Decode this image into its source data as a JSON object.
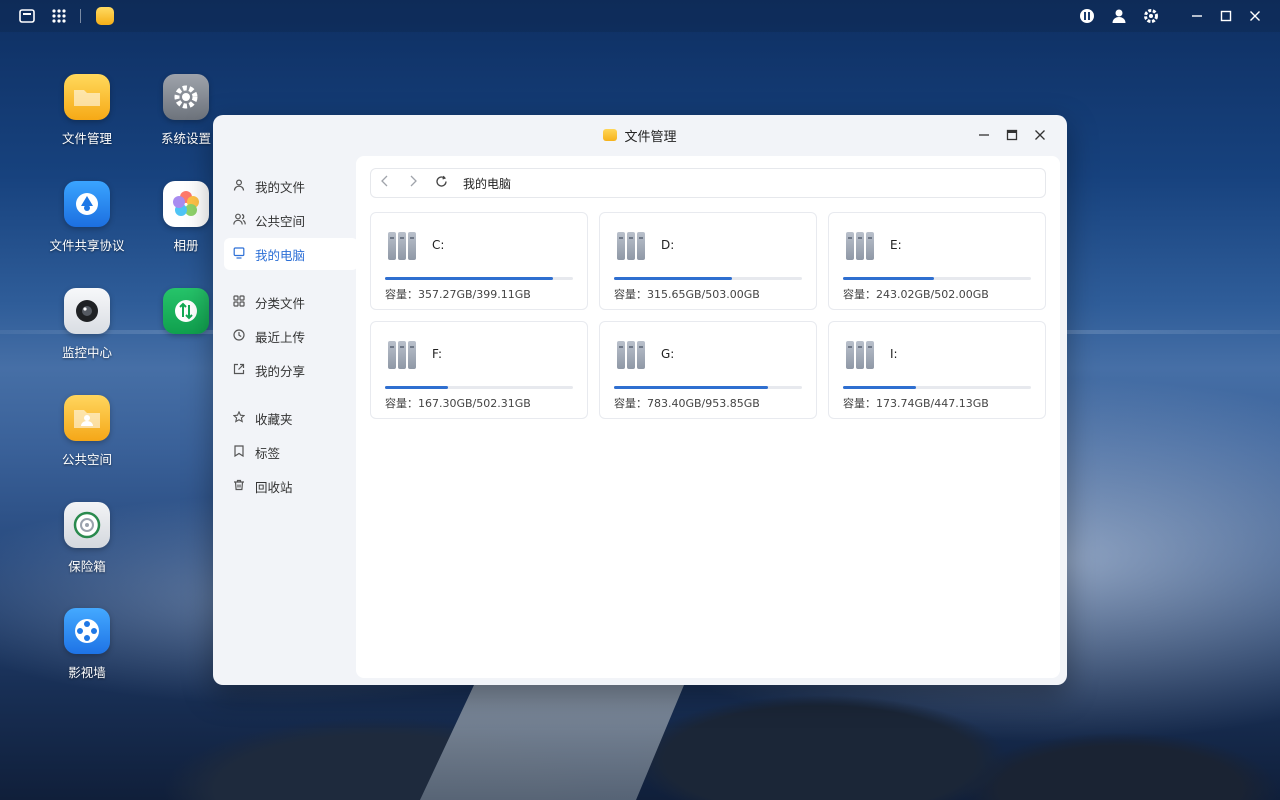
{
  "desktop": {
    "icons": [
      {
        "label": "文件管理",
        "icon": "folder-icon"
      },
      {
        "label": "系统设置",
        "icon": "gear-icon"
      },
      {
        "label": "文件共享协议",
        "icon": "share-protocol-icon"
      },
      {
        "label": "相册",
        "icon": "photos-icon"
      },
      {
        "label": "监控中心",
        "icon": "camera-icon"
      },
      {
        "label": "公共空间",
        "icon": "shared-folder-icon"
      },
      {
        "label": "保险箱",
        "icon": "safe-icon"
      },
      {
        "label": "影视墙",
        "icon": "film-reel-icon"
      }
    ]
  },
  "topbar": {
    "left_icons": [
      "show-desktop-icon",
      "app-grid-icon",
      "file-manager-app-icon"
    ],
    "right_icons": [
      "nas-status-icon",
      "user-icon",
      "settings-icon",
      "minimize-icon",
      "maximize-icon",
      "close-icon"
    ]
  },
  "window": {
    "title": "文件管理",
    "sidebar": {
      "items": [
        {
          "label": "我的文件",
          "icon": "user-icon"
        },
        {
          "label": "公共空间",
          "icon": "group-icon"
        },
        {
          "label": "我的电脑",
          "icon": "computer-icon",
          "active": true
        },
        {
          "label": "分类文件",
          "icon": "grid-icon"
        },
        {
          "label": "最近上传",
          "icon": "clock-icon"
        },
        {
          "label": "我的分享",
          "icon": "share-icon"
        },
        {
          "label": "收藏夹",
          "icon": "star-icon"
        },
        {
          "label": "标签",
          "icon": "tag-icon"
        },
        {
          "label": "回收站",
          "icon": "trash-icon"
        }
      ]
    },
    "address": {
      "path": "我的电脑"
    },
    "drives": [
      {
        "name": "C:",
        "capacity": "容量：357.27GB/399.11GB",
        "used_fraction": 0.895
      },
      {
        "name": "D:",
        "capacity": "容量：315.65GB/503.00GB",
        "used_fraction": 0.628
      },
      {
        "name": "E:",
        "capacity": "容量：243.02GB/502.00GB",
        "used_fraction": 0.484
      },
      {
        "name": "F:",
        "capacity": "容量：167.30GB/502.31GB",
        "used_fraction": 0.333
      },
      {
        "name": "G:",
        "capacity": "容量：783.40GB/953.85GB",
        "used_fraction": 0.821
      },
      {
        "name": "I:",
        "capacity": "容量：173.74GB/447.13GB",
        "used_fraction": 0.389
      }
    ]
  },
  "colors": {
    "accent": "#2c6fd6",
    "progress": "#2f6fd0"
  }
}
